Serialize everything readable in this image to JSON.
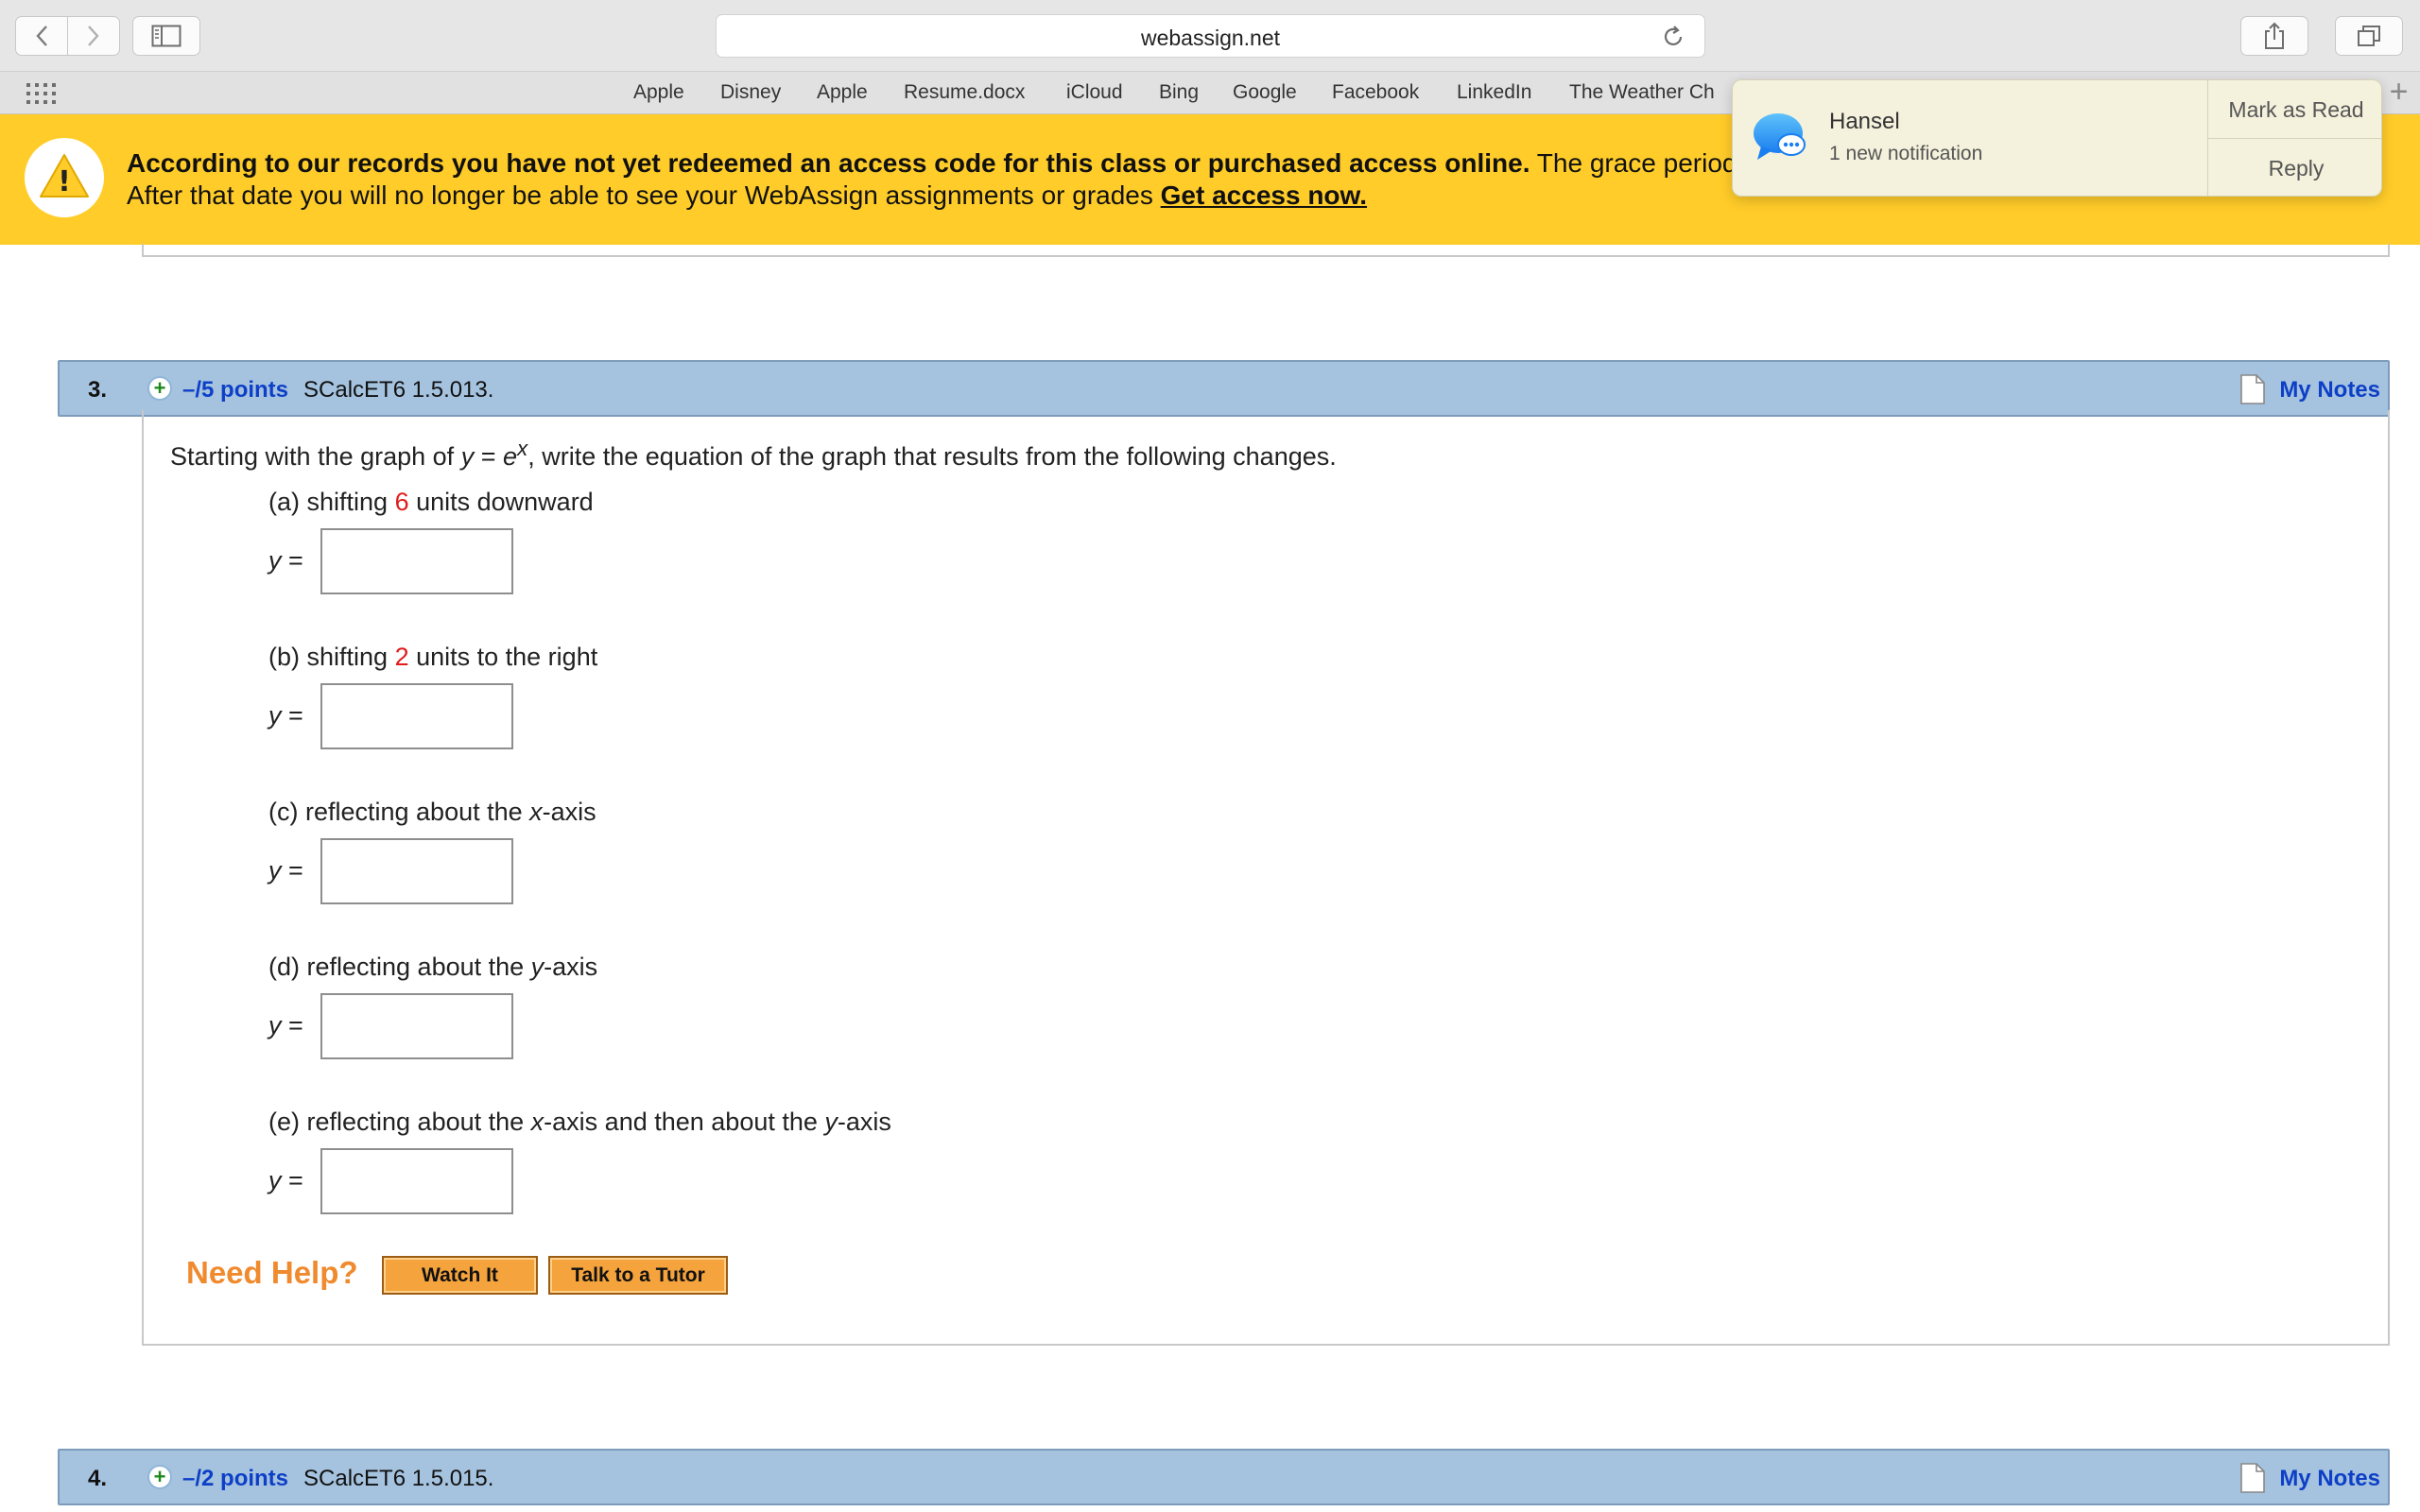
{
  "browser": {
    "url": "webassign.net",
    "favorites": [
      "Apple",
      "Disney",
      "Apple",
      "Resume.docx",
      "iCloud",
      "Bing",
      "Google",
      "Facebook",
      "LinkedIn",
      "The Weather Ch"
    ],
    "add_tab_label": "+"
  },
  "banner": {
    "bold_text": "According to our records you have not yet redeemed an access code for this class or purchased access online.",
    "tail_text": " The grace period",
    "line2_text": "After that date you will no longer be able to see your WebAssign assignments or grades ",
    "link_text": "Get access now.",
    "warning_glyph": "!"
  },
  "notification": {
    "title": "Hansel",
    "subtitle": "1 new notification",
    "mark_read_label": "Mark as Read",
    "reply_label": "Reply"
  },
  "questions": [
    {
      "number": "3.",
      "points": "–/5 points",
      "code": "SCalcET6 1.5.013.",
      "notes_label": "My Notes",
      "prompt_before": "Starting with the graph of ",
      "prompt_y": "y",
      "prompt_eq": " = ",
      "prompt_e": "e",
      "prompt_x": "x",
      "prompt_after": ", write the equation of the graph that results from the following changes.",
      "y_label": "y",
      "equals": " =",
      "parts": [
        {
          "pre": "(a) shifting ",
          "num": "6",
          "post": " units downward"
        },
        {
          "pre": "(b) shifting ",
          "num": "2",
          "post": " units to the right"
        },
        {
          "pre": "(c) reflecting about the ",
          "var": "x",
          "post": "-axis"
        },
        {
          "pre": "(d) reflecting about the ",
          "var": "y",
          "post": "-axis"
        },
        {
          "pre": "(e) reflecting about the ",
          "var": "x",
          "mid": "-axis and then about the ",
          "var2": "y",
          "post": "-axis"
        }
      ],
      "need_help_label": "Need Help?",
      "watch_label": "Watch It",
      "tutor_label": "Talk to a Tutor"
    },
    {
      "number": "4.",
      "points": "–/2 points",
      "code": "SCalcET6 1.5.015.",
      "notes_label": "My Notes"
    }
  ],
  "colors": {
    "banner": "#ffcc29",
    "question_header": "#a5c3df",
    "link_blue": "#0d3fc7",
    "highlight_red": "#e01b1b",
    "help_orange": "#f08a2e"
  },
  "icons": [
    "back-chevron-icon",
    "forward-chevron-icon",
    "sidebar-icon",
    "reload-icon",
    "share-icon",
    "tabs-icon",
    "favorites-grid-icon",
    "warning-icon",
    "messages-icon",
    "plus-icon",
    "note-icon"
  ]
}
